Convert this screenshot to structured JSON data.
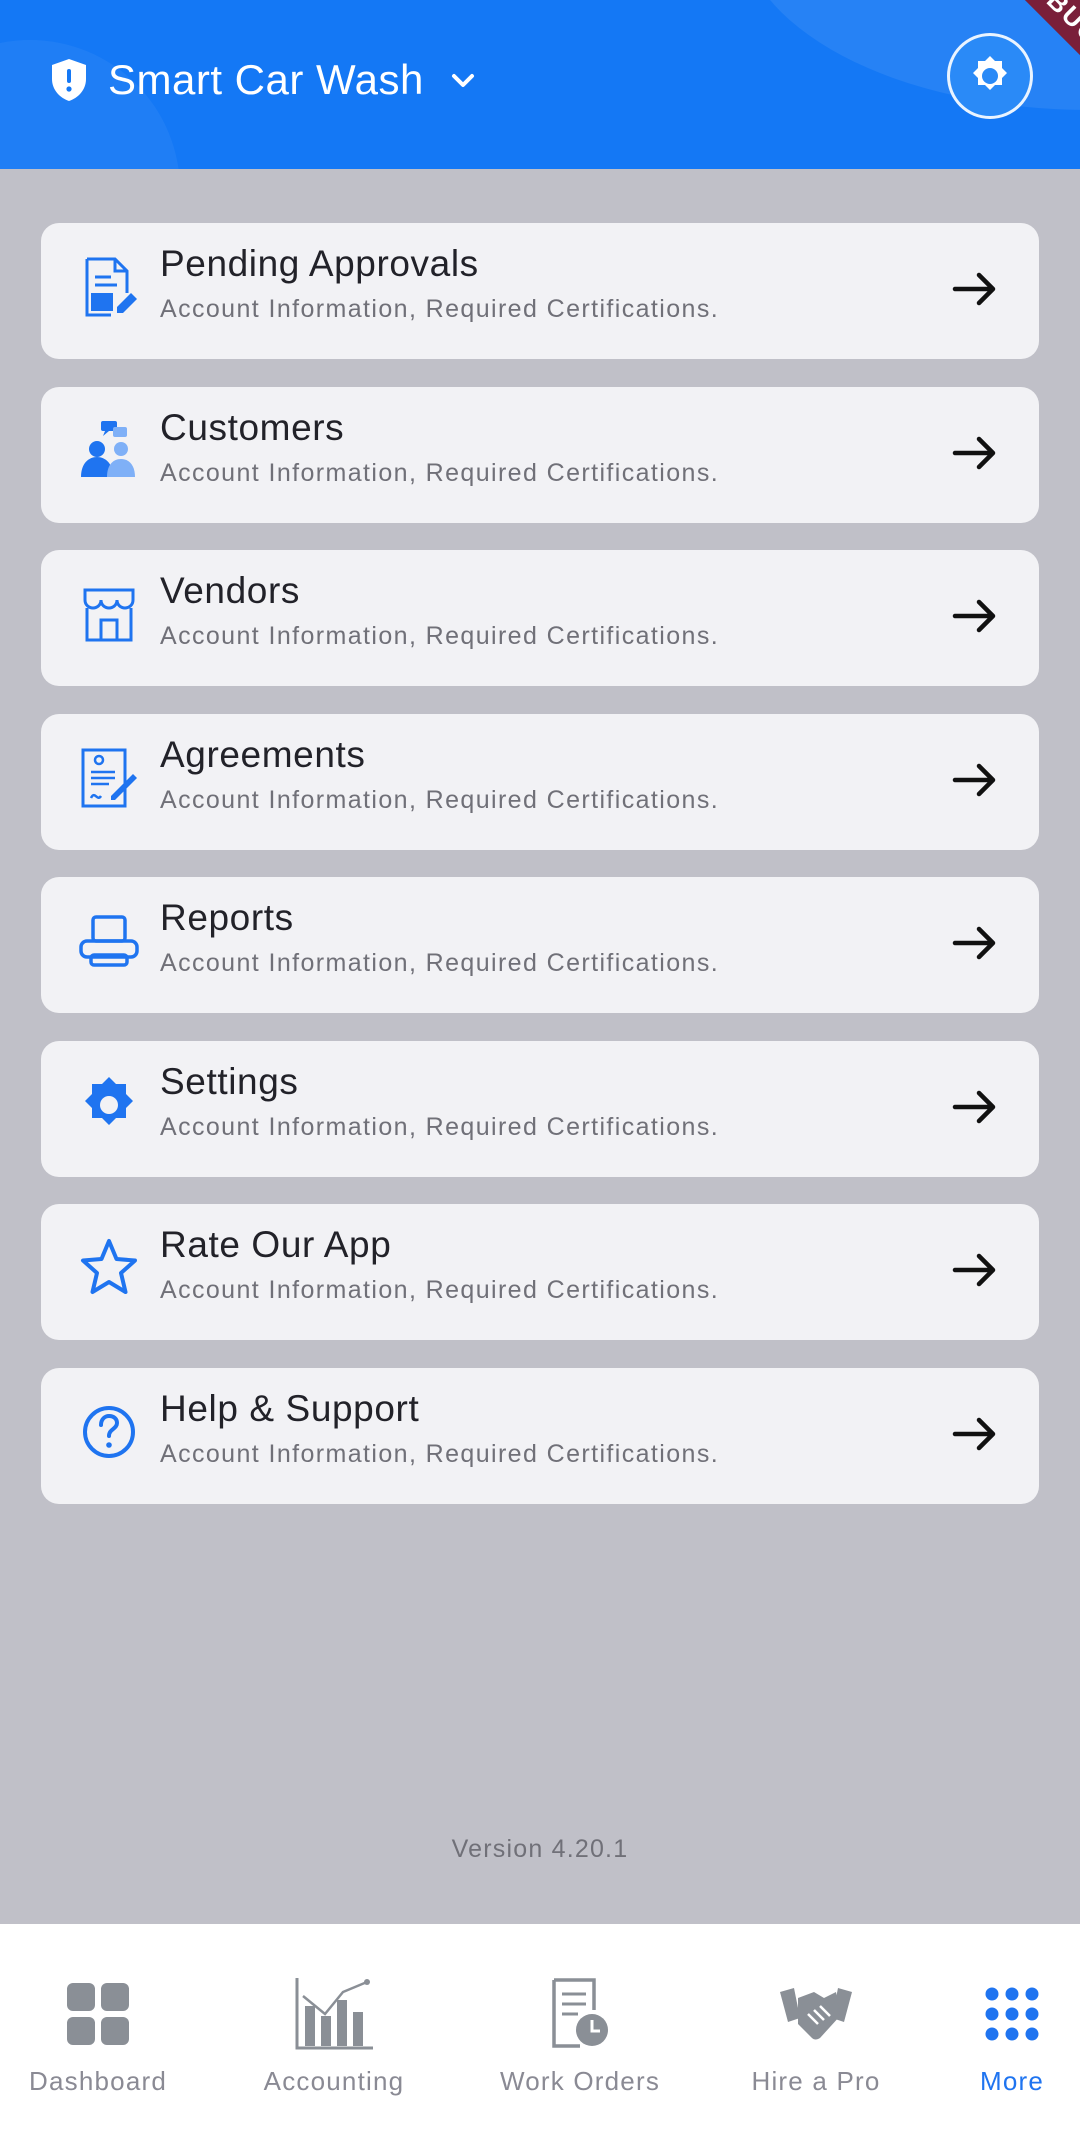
{
  "header": {
    "title": "Smart Car Wash",
    "brand_icon": "shield-alert-icon",
    "dropdown_icon": "chevron-down-icon",
    "settings_icon": "gear-icon",
    "debug_banner": "DEBUG",
    "accent": "#1478f5"
  },
  "menu": {
    "items": [
      {
        "label": "Pending Approvals",
        "sub": "Account Information, Required Certifications.",
        "icon": "document-edit-icon"
      },
      {
        "label": "Customers",
        "sub": "Account Information, Required Certifications.",
        "icon": "customers-icon"
      },
      {
        "label": "Vendors",
        "sub": "Account Information, Required Certifications.",
        "icon": "storefront-icon"
      },
      {
        "label": "Agreements",
        "sub": "Account Information, Required Certifications.",
        "icon": "contract-icon"
      },
      {
        "label": "Reports",
        "sub": "Account Information, Required Certifications.",
        "icon": "printer-icon"
      },
      {
        "label": "Settings",
        "sub": "Account Information, Required Certifications.",
        "icon": "gear-icon"
      },
      {
        "label": "Rate Our App",
        "sub": "Account Information, Required Certifications.",
        "icon": "star-icon"
      },
      {
        "label": "Help & Support",
        "sub": "Account Information, Required Certifications.",
        "icon": "help-circle-icon"
      }
    ],
    "arrow_icon": "arrow-right-icon"
  },
  "footer": {
    "version": "Version 4.20.1"
  },
  "bottom_nav": {
    "items": [
      {
        "label": "Dashboard",
        "icon": "dashboard-grid-icon",
        "active": false
      },
      {
        "label": "Accounting",
        "icon": "bar-chart-icon",
        "active": false
      },
      {
        "label": "Work Orders",
        "icon": "clipboard-clock-icon",
        "active": false
      },
      {
        "label": "Hire a Pro",
        "icon": "handshake-icon",
        "active": false
      },
      {
        "label": "More",
        "icon": "dots-grid-icon",
        "active": true
      }
    ],
    "active_color": "#1f74f0",
    "inactive_color": "#8a8a94"
  }
}
